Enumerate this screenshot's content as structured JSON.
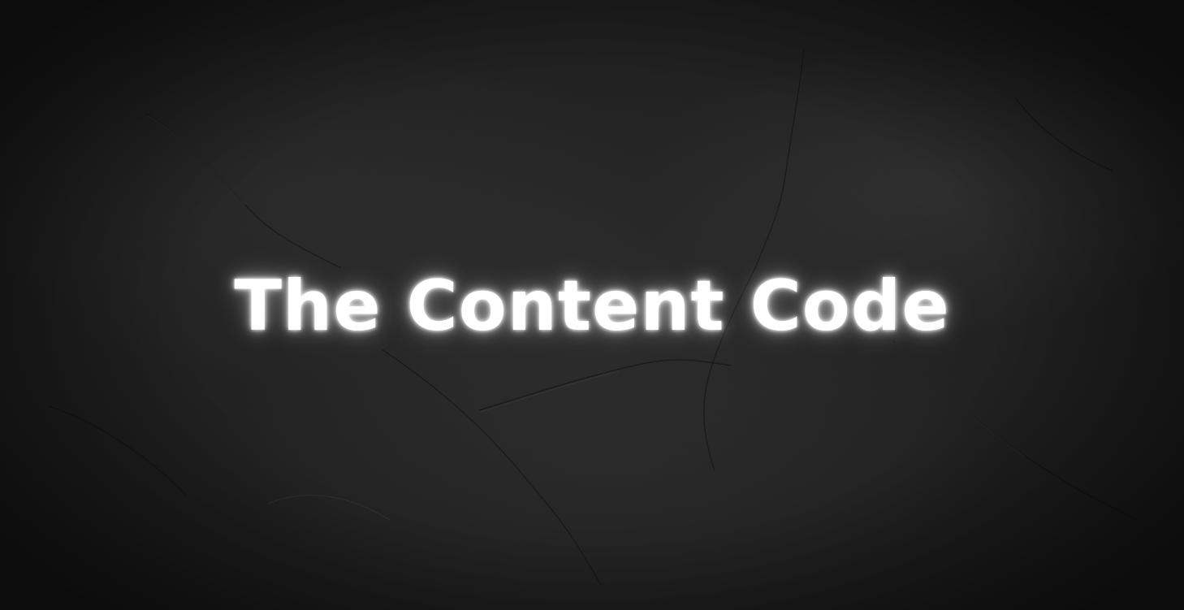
{
  "headline": "The Content Code",
  "colors": {
    "background": "#1f1f1f",
    "text": "#ffffff",
    "glow": "#ffffff"
  }
}
